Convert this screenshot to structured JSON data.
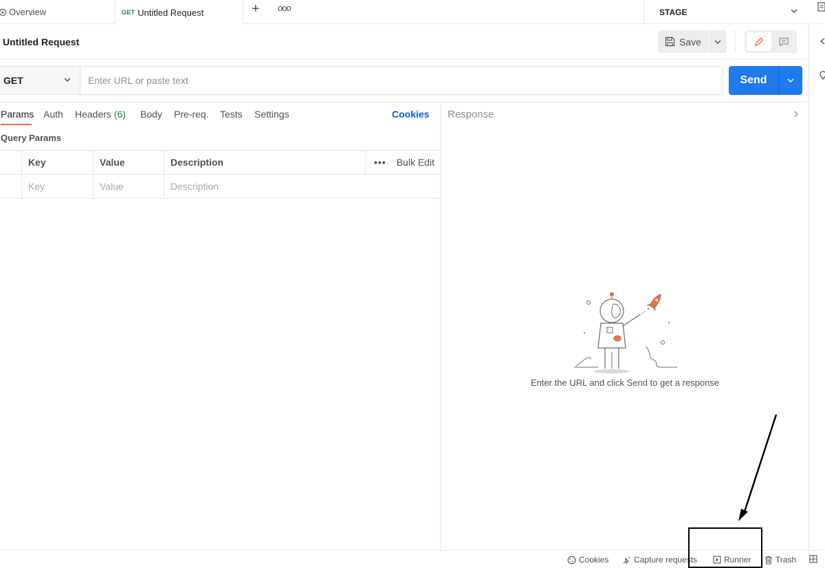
{
  "tabs": {
    "overview_label": "Overview",
    "request_method": "GET",
    "request_label": "Untitled Request",
    "add_label": "+",
    "more_label": "ooo"
  },
  "environment": {
    "selected": "STAGE"
  },
  "request": {
    "title": "Untitled Request",
    "save_label": "Save",
    "method": "GET",
    "url_placeholder": "Enter URL or paste text",
    "send_label": "Send"
  },
  "request_tabs": [
    {
      "label": "Params",
      "active": true
    },
    {
      "label": "Auth"
    },
    {
      "label": "Headers",
      "count": "(6)"
    },
    {
      "label": "Body"
    },
    {
      "label": "Pre-req."
    },
    {
      "label": "Tests"
    },
    {
      "label": "Settings"
    }
  ],
  "cookies_link": "Cookies",
  "query_params": {
    "title": "Query Params",
    "columns": [
      "Key",
      "Value",
      "Description"
    ],
    "bulk_edit": "Bulk Edit",
    "more": "•••",
    "placeholders": [
      "Key",
      "Value",
      "Description"
    ]
  },
  "response": {
    "title": "Response",
    "empty_message": "Enter the URL and click Send to get a response"
  },
  "statusbar": {
    "cookies": "Cookies",
    "capture": "Capture requests",
    "runner": "Runner",
    "trash": "Trash"
  },
  "colors": {
    "accent_orange": "#ff6c37",
    "send_blue": "#1f7aec",
    "method_green": "#0b8c3e",
    "link_blue": "#0b5ed7"
  }
}
